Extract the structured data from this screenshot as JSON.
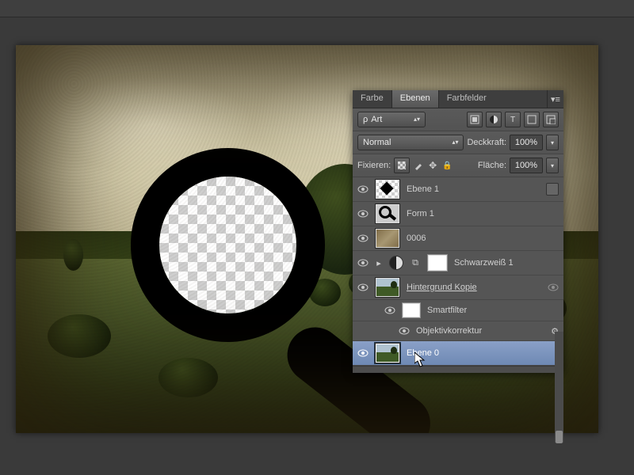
{
  "tabs": {
    "color": "Farbe",
    "layers": "Ebenen",
    "swatches": "Farbfelder"
  },
  "filter_row": {
    "kind_prefix": "ρ",
    "kind_label": "Art"
  },
  "blend_row": {
    "mode": "Normal",
    "opacity_label": "Deckkraft:",
    "opacity_value": "100%"
  },
  "lock_row": {
    "lock_label": "Fixieren:",
    "fill_label": "Fläche:",
    "fill_value": "100%"
  },
  "layers": [
    {
      "name": "Ebene 1"
    },
    {
      "name": "Form 1"
    },
    {
      "name": "0006"
    },
    {
      "name": "Schwarzweiß 1"
    },
    {
      "name": "Hintergrund Kopie"
    },
    {
      "name": "Smartfilter"
    },
    {
      "name": "Objektivkorrektur"
    },
    {
      "name": "Ebene 0"
    }
  ]
}
